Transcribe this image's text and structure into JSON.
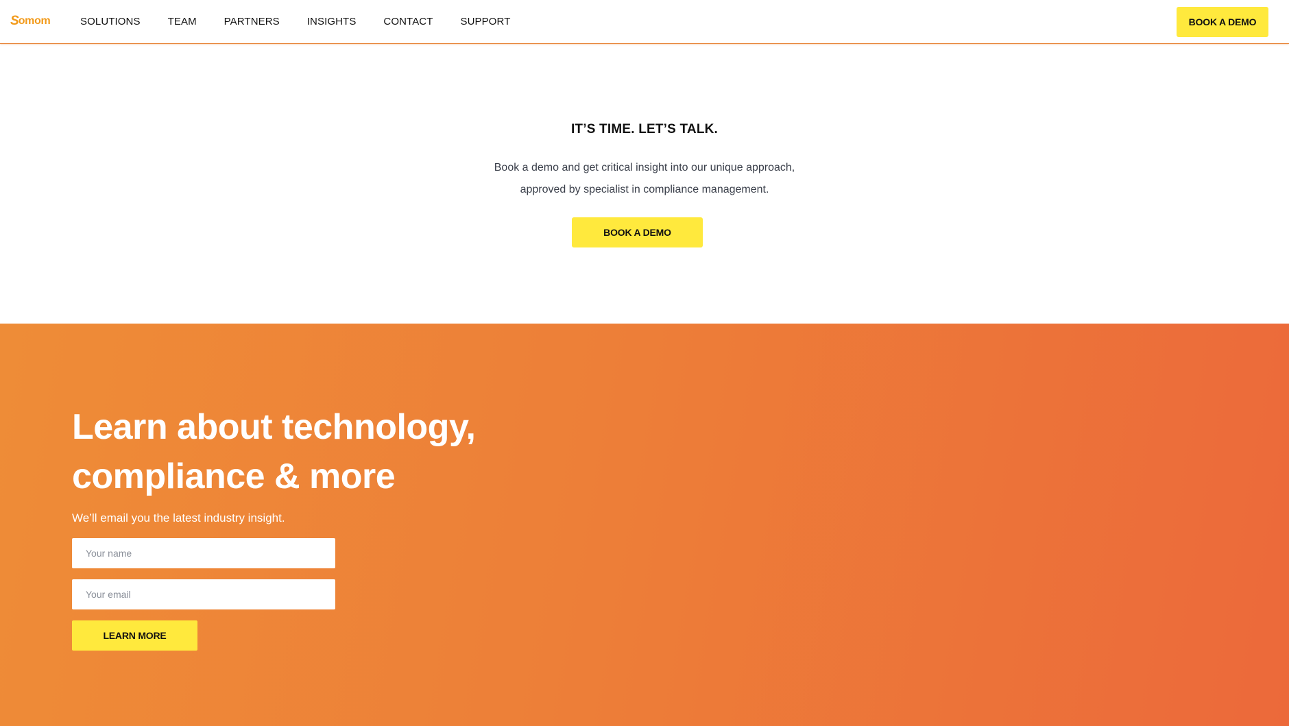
{
  "header": {
    "logo_mark": "S",
    "logo_text": "omom",
    "nav": [
      {
        "label": "SOLUTIONS"
      },
      {
        "label": "TEAM"
      },
      {
        "label": "PARTNERS"
      },
      {
        "label": "INSIGHTS"
      },
      {
        "label": "CONTACT"
      },
      {
        "label": "SUPPORT"
      }
    ],
    "cta_label": "BOOK A DEMO"
  },
  "cta": {
    "title": "IT’S TIME. LET’S TALK.",
    "text_line1": "Book a demo and get critical insight into our unique approach,",
    "text_line2": "approved by specialist in compliance management.",
    "button_label": "BOOK A DEMO"
  },
  "newsletter": {
    "heading_line1": "Learn about technology,",
    "heading_line2": "compliance & more",
    "subtext": "We’ll email you the latest industry insight.",
    "name_placeholder": "Your name",
    "email_placeholder": "Your email",
    "button_label": "LEARN MORE"
  },
  "colors": {
    "accent_yellow": "#ffe93d",
    "brand_orange": "#f29a1a",
    "gradient_start": "#ee8c37",
    "gradient_end": "#ec693a"
  }
}
